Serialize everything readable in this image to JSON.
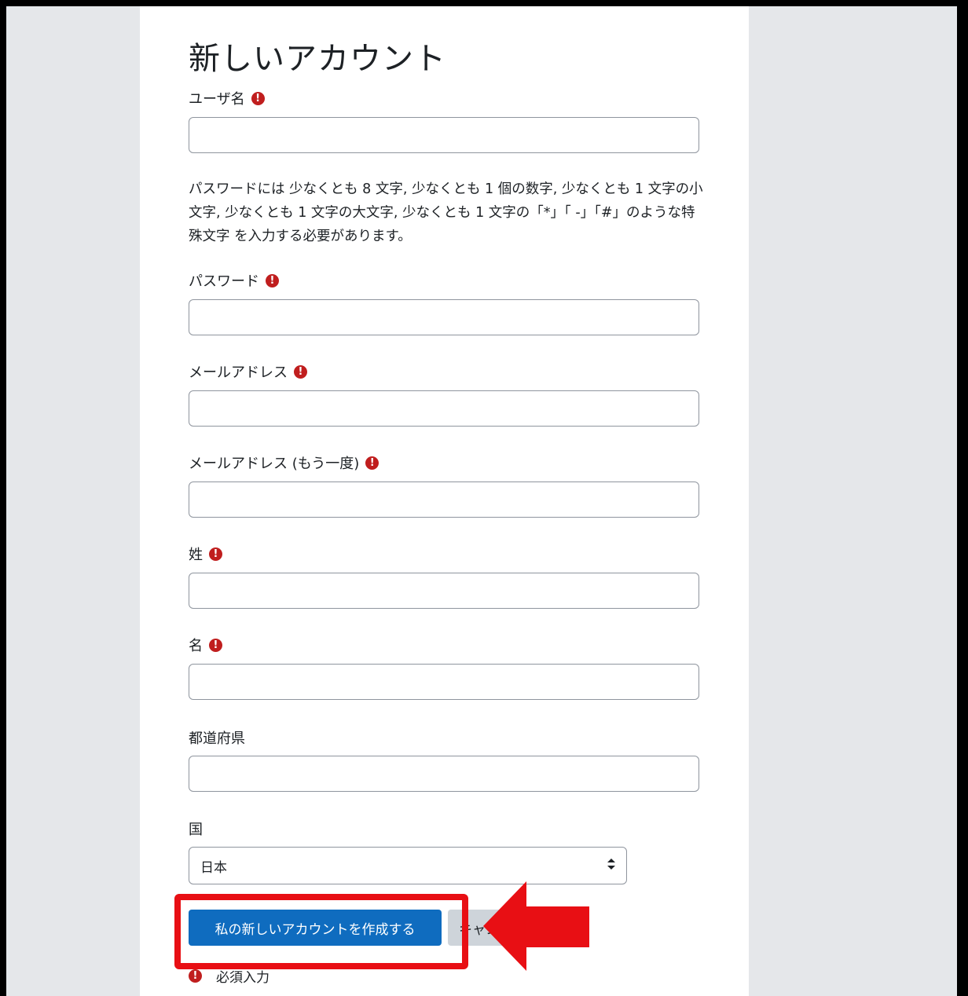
{
  "form": {
    "title": "新しいアカウント",
    "username_label": "ユーザ名",
    "password_policy": "パスワードには 少なくとも 8 文字, 少なくとも 1 個の数字, 少なくとも 1 文字の小文字, 少なくとも 1 文字の大文字, 少なくとも 1 文字の「*」「 -」「#」のような特殊文字 を入力する必要があります。",
    "password_label": "パスワード",
    "email_label": "メールアドレス",
    "email_confirm_label": "メールアドレス (もう一度)",
    "lastname_label": "姓",
    "firstname_label": "名",
    "prefecture_label": "都道府県",
    "country_label": "国",
    "country_value": "日本",
    "submit_label": "私の新しいアカウントを作成する",
    "cancel_label": "キャンセル",
    "required_note": "必須入力",
    "required_icon": "!"
  },
  "colors": {
    "primary_button": "#0f6cbf",
    "required_icon": "#c01e1e",
    "highlight": "#e80f14",
    "page_background": "#e5e7ea"
  },
  "icons": {
    "required": "exclamation-circle-icon",
    "select_arrows": "sort-arrows-icon",
    "annotation_arrow": "red-left-arrow-icon"
  }
}
